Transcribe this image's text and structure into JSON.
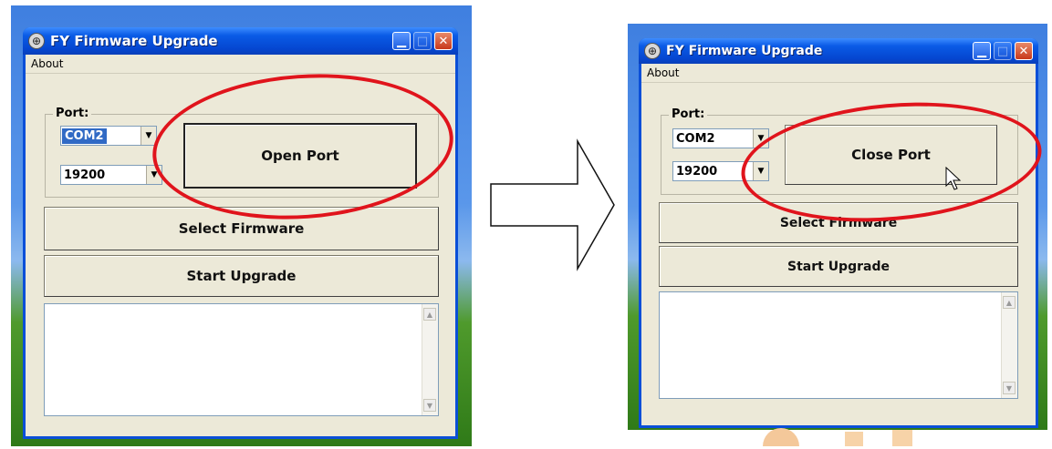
{
  "window_left": {
    "title": "FY Firmware Upgrade",
    "menu": [
      "About"
    ],
    "port_label": "Port:",
    "port_value": "COM2",
    "baud_value": "19200",
    "port_button": "Open Port",
    "select_button": "Select Firmware",
    "upgrade_button": "Start Upgrade"
  },
  "window_right": {
    "title": "FY Firmware Upgrade",
    "menu": [
      "About"
    ],
    "port_label": "Port:",
    "port_value": "COM2",
    "baud_value": "19200",
    "port_button": "Close Port",
    "select_button": "Select Firmware",
    "upgrade_button": "Start Upgrade"
  },
  "icons": {
    "app": "app-globe-icon",
    "minimize": "minimize-icon",
    "maximize": "maximize-icon",
    "close": "close-icon",
    "combo_arrow": "chevron-down-icon",
    "scroll_up": "scroll-up-icon",
    "scroll_down": "scroll-down-icon",
    "transition": "right-arrow-icon",
    "pointer": "mouse-pointer-icon"
  },
  "colors": {
    "highlight_ellipse": "#e0141c",
    "titlebar": "#0a5be6",
    "window_face": "#ece9d8",
    "selection": "#316ac5"
  }
}
